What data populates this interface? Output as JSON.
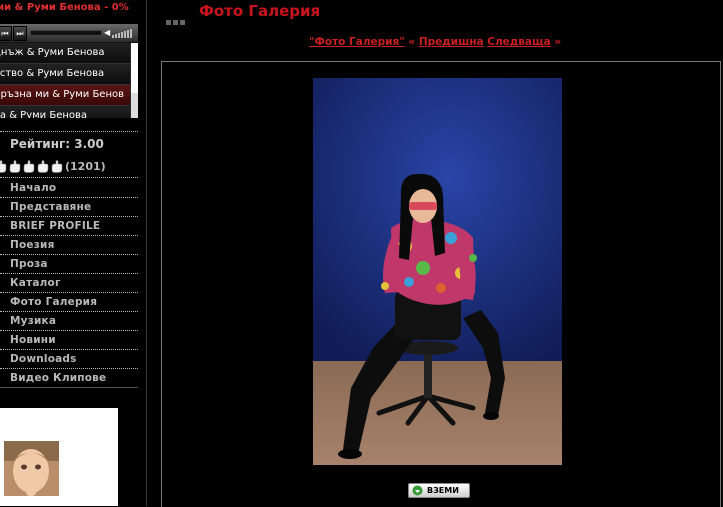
{
  "player": {
    "title": "ми & Руми Бенова - 0%",
    "progress_fraction": 0.0,
    "tracks": [
      "днъж & Руми Бенова",
      "тство & Руми Бенова",
      "иръзна ми & Руми Бенов",
      "ва & Руми Бенова"
    ],
    "active_track_index": 2
  },
  "rating": {
    "label": "Рейтинг: 3.00",
    "count": "(1201)",
    "hands": 5
  },
  "nav": {
    "items": [
      "Начало",
      "Представяне",
      "BRIEF PROFILE",
      "Поезия",
      "Проза",
      "Каталог",
      "Фото Галерия",
      "Музика",
      "Новини",
      "Downloads",
      "Видео Клипове"
    ]
  },
  "header": {
    "title": "Фото Галерия"
  },
  "breadcrumb": {
    "gallery_link": "\"Фото Галерия\"",
    "sep": "«",
    "prev_link": "Предишна",
    "next_link": "Следваща",
    "end": "»"
  },
  "download": {
    "label": "ВЗЕМИ"
  },
  "colors": {
    "accent": "#c8141c",
    "background": "#000000",
    "photo_backdrop": "#1c2b6e"
  }
}
